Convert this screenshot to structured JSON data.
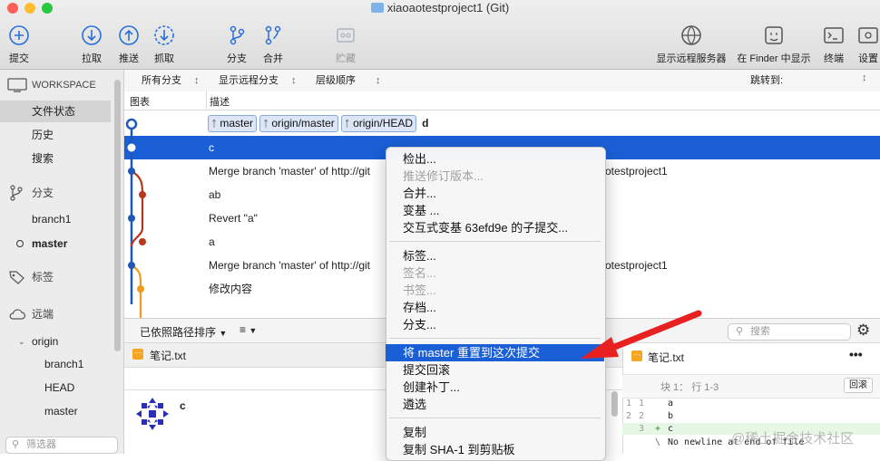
{
  "window": {
    "title": "xiaoaotestproject1 (Git)"
  },
  "toolbar": {
    "commit": "提交",
    "pull": "拉取",
    "push": "推送",
    "fetch": "抓取",
    "branch": "分支",
    "merge": "合并",
    "stash": "贮藏",
    "show_remote": "显示远程服务器",
    "show_finder": "在 Finder 中显示",
    "terminal": "终端",
    "settings": "设置"
  },
  "sidebar": {
    "workspace": "WORKSPACE",
    "file_status": "文件状态",
    "history": "历史",
    "search": "搜索",
    "branches": "分支",
    "branch1": "branch1",
    "master": "master",
    "tags": "标签",
    "remotes": "远端",
    "origin": "origin",
    "origin_items": [
      "branch1",
      "HEAD",
      "master"
    ],
    "filter_placeholder": "筛选器"
  },
  "filters": {
    "all_branches": "所有分支",
    "show_remote": "显示远程分支",
    "order": "层级顺序",
    "jump_to": "跳转到:"
  },
  "columns": {
    "graph": "图表",
    "description": "描述"
  },
  "commits": [
    {
      "refs": [
        "master",
        "origin/master",
        "origin/HEAD"
      ],
      "desc": "d"
    },
    {
      "refs": [],
      "desc": "c"
    },
    {
      "refs": [],
      "desc": "Merge branch 'master' of http://git",
      "tail": "otestproject1"
    },
    {
      "refs": [],
      "desc": "ab"
    },
    {
      "refs": [],
      "desc": "Revert \"a\""
    },
    {
      "refs": [],
      "desc": "a"
    },
    {
      "refs": [],
      "desc": "Merge branch 'master' of http://git",
      "tail": "otestproject1"
    },
    {
      "refs": [],
      "desc": "修改内容"
    }
  ],
  "bottom": {
    "sort_label": "已依照路径排序",
    "file_name": "笔记.txt",
    "commit_author_initial": "c",
    "search_placeholder": "搜索",
    "diff_file": "笔记.txt",
    "hunk_label": "块 1： 行 1-3",
    "revert_button": "回滚",
    "diff_lines": [
      {
        "old": "1",
        "new": "1",
        "sign": "",
        "text": "a"
      },
      {
        "old": "2",
        "new": "2",
        "sign": "",
        "text": "b"
      },
      {
        "old": "",
        "new": "3",
        "sign": "+",
        "text": "c"
      },
      {
        "old": "",
        "new": "",
        "sign": "\\",
        "text": " No newline at end of file"
      }
    ]
  },
  "context_menu": {
    "group1": [
      "检出...",
      "推送修订版本...",
      "合并...",
      "变基 ...",
      "交互式变基 63efd9e 的子提交..."
    ],
    "group1_disabled": [
      false,
      true,
      false,
      false,
      false
    ],
    "group2": [
      "标签...",
      "签名...",
      "书签...",
      "存档...",
      "分支..."
    ],
    "group2_disabled": [
      false,
      true,
      true,
      false,
      false
    ],
    "group3": [
      "将 master 重置到这次提交",
      "提交回滚",
      "创建补丁...",
      "遴选"
    ],
    "group4": [
      "复制",
      "复制 SHA-1 到剪贴板"
    ]
  },
  "watermark": "@稀土掘金技术社区",
  "colors": {
    "selection": "#1a5fd6",
    "arrow": "#e8201f",
    "graph_blue": "#1d58b8",
    "graph_red": "#b8351d",
    "graph_orange": "#f09a1c"
  }
}
